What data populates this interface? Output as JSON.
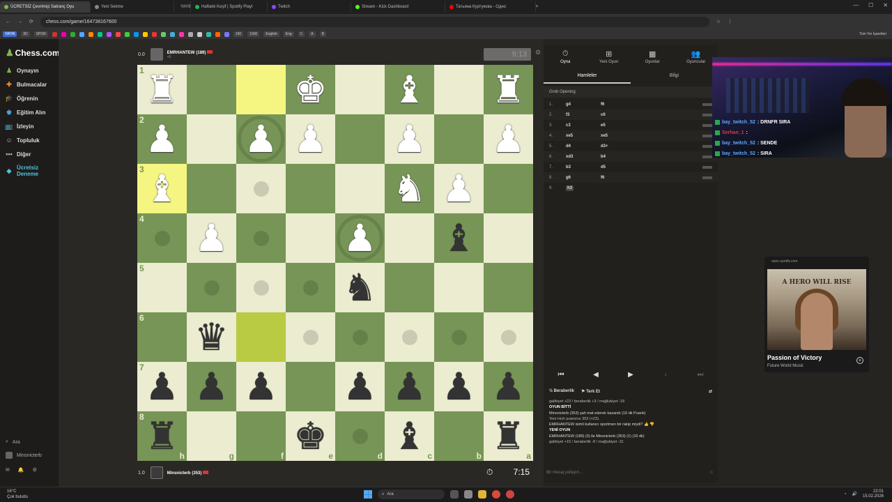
{
  "browser": {
    "tabs": [
      {
        "label": "ÜCRETSİZ Çevrimiçi Satranç Oyu",
        "color": "#81b64c",
        "active": true
      },
      {
        "label": "Yeni Sekme",
        "color": "#888888",
        "active": false
      },
      {
        "label": "YAYIN",
        "color": "#5b6bd8",
        "active": false
      },
      {
        "label": "Haftalık Keşif | Spotify Playl",
        "color": "#1db954",
        "active": false
      },
      {
        "label": "Twitch",
        "color": "#9146ff",
        "active": false
      },
      {
        "label": "Stream - Kick Dashboard",
        "color": "#53fc18",
        "active": false
      },
      {
        "label": "Татьяна Куртукова - Одно",
        "color": "#ff0000",
        "active": false
      }
    ],
    "url": "chess.com/game/164738167600",
    "bookmarks": [
      "YAYIN",
      "3D",
      "SPOR",
      "100",
      "1000",
      "English",
      "Eng",
      "C",
      "A",
      "B"
    ],
    "bookmarks_right": "Tüm Yer İşaretleri"
  },
  "sidebar": {
    "logo": "Chess.com",
    "items": [
      {
        "label": "Oynayın",
        "icon": "play-icon"
      },
      {
        "label": "Bulmacalar",
        "icon": "puzzle-icon"
      },
      {
        "label": "Öğrenin",
        "icon": "learn-icon"
      },
      {
        "label": "Eğitim Alın",
        "icon": "coach-icon"
      },
      {
        "label": "İzleyin",
        "icon": "watch-icon"
      },
      {
        "label": "Topluluk",
        "icon": "community-icon"
      },
      {
        "label": "Diğer",
        "icon": "more-icon"
      },
      {
        "label": "Ücretsiz Deneme",
        "icon": "diamond-icon"
      }
    ],
    "search": "Ara",
    "user": "Minsnicterb"
  },
  "players": {
    "top": {
      "score": "0.0",
      "name": "EMRHANTEW",
      "rating": "(189)",
      "sub": "+1",
      "clock": "9:13"
    },
    "bottom": {
      "score": "1.0",
      "name": "Minsnicterb",
      "rating": "(353)",
      "clock": "7:15"
    }
  },
  "board": {
    "rank_labels": [
      "1",
      "2",
      "3",
      "4",
      "5",
      "6",
      "7",
      "8"
    ],
    "file_labels": [
      "h",
      "g",
      "f",
      "e",
      "d",
      "c",
      "b",
      "a"
    ],
    "rows": [
      [
        "wR",
        "",
        "",
        "wK",
        "",
        "wB",
        "",
        "wR"
      ],
      [
        "wP",
        "",
        "wP",
        "wP",
        "",
        "wP",
        "",
        "wP"
      ],
      [
        "wB",
        "",
        "",
        "",
        "",
        "wN",
        "wP",
        ""
      ],
      [
        "",
        "wP",
        "",
        "",
        "wP",
        "",
        "bB",
        ""
      ],
      [
        "",
        "",
        "",
        "",
        "bN",
        "",
        "",
        ""
      ],
      [
        "",
        "bQ",
        "",
        "",
        "",
        "",
        "",
        ""
      ],
      [
        "bP",
        "bP",
        "bP",
        "",
        "bP",
        "bP",
        "bP",
        "bP"
      ],
      [
        "bR",
        "",
        "",
        "bK",
        "",
        "bB",
        "",
        "bR"
      ]
    ],
    "highlights": [
      [
        0,
        2
      ],
      [
        2,
        0
      ],
      [
        5,
        2
      ]
    ],
    "hints": [
      [
        2,
        2
      ],
      [
        3,
        0
      ],
      [
        3,
        2
      ],
      [
        4,
        1
      ],
      [
        4,
        2
      ],
      [
        4,
        3
      ],
      [
        5,
        3
      ],
      [
        5,
        4
      ],
      [
        5,
        5
      ],
      [
        5,
        6
      ],
      [
        5,
        7
      ],
      [
        7,
        4
      ]
    ],
    "rings": [
      [
        1,
        2
      ],
      [
        3,
        4
      ]
    ]
  },
  "panel": {
    "tabs": [
      {
        "label": "Oyna",
        "icon": "clock-icon",
        "active": true
      },
      {
        "label": "Yeni Oyun",
        "icon": "plus-icon",
        "active": false
      },
      {
        "label": "Oyunlar",
        "icon": "grid-icon",
        "active": false
      },
      {
        "label": "Oyuncular",
        "icon": "people-icon",
        "active": false
      }
    ],
    "subtabs": [
      {
        "label": "Hamleler",
        "active": true
      },
      {
        "label": "Bilgi",
        "active": false
      }
    ],
    "opening": "Grob Opening",
    "moves": [
      {
        "n": "1.",
        "w": "g4",
        "b": "f6"
      },
      {
        "n": "2.",
        "w": "f3",
        "b": "c6"
      },
      {
        "n": "3.",
        "w": "c3",
        "b": "e5"
      },
      {
        "n": "4.",
        "w": "xe5",
        "b": "xe5"
      },
      {
        "n": "5.",
        "w": "d4",
        "b": "d3+"
      },
      {
        "n": "6.",
        "w": "xd3",
        "b": "b4"
      },
      {
        "n": "7.",
        "w": "b3",
        "b": "d5"
      },
      {
        "n": "8.",
        "w": "g6",
        "b": "f6"
      },
      {
        "n": "9.",
        "w": "h3",
        "b": ""
      }
    ],
    "draw_label": "Beraberlik",
    "resign_label": "Terk Et",
    "chat_lines": [
      {
        "text": "galibiyet +23 / beraberlik +3 / mağlubiyet -18",
        "style": ""
      },
      {
        "text": "OYUN BİTTİ",
        "style": "h"
      },
      {
        "text": "Minsnicterb (353) şah mat ederek kazandı (10 dk Puanlı)",
        "style": "b"
      },
      {
        "text": "Yeni Hızlı puanınız 353 (+23).",
        "style": ""
      },
      {
        "text": "EMRHANTEW isimli kullanıcı sportmen bir rakip miydi?",
        "style": "b"
      },
      {
        "text": "YENİ OYUN",
        "style": "h"
      },
      {
        "text": "EMRHANTEW (189) (0) ile Minsnicterb (353) (1) (10 dk)",
        "style": "b"
      },
      {
        "text": "galibiyet +15 / beraberlik -8 / mağlubiyet -31",
        "style": ""
      }
    ],
    "chat_placeholder": "Bir mesaj yollayın..."
  },
  "twitch_chat": [
    {
      "user": "bay_twitch_52",
      "msg": ": DRNFR SIRA",
      "red": false
    },
    {
      "user": "Serhan_1",
      "msg": ":",
      "red": true
    },
    {
      "user": "bay_twitch_52",
      "msg": ": SENDE",
      "red": false
    },
    {
      "user": "bay_twitch_52",
      "msg": ": SIRA",
      "red": false
    }
  ],
  "spotify": {
    "url": "open.spotify.com",
    "art_text": "A HERO WILL RISE",
    "title": "Passion of Victory",
    "artist": "Future World Music"
  },
  "taskbar": {
    "weather_temp": "16°C",
    "weather_desc": "Çok bulutlu",
    "search": "Ara",
    "time": "22:01",
    "date": "15.02.2026"
  }
}
